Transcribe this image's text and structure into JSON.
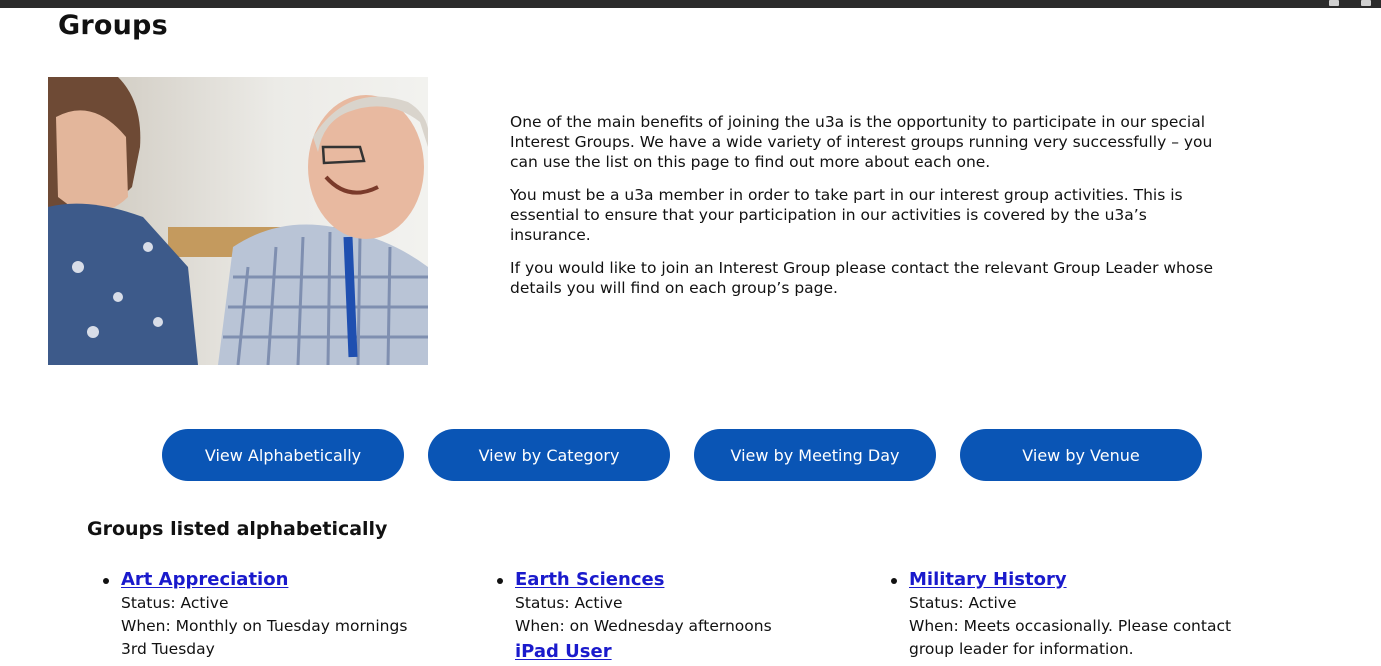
{
  "page": {
    "title": "Groups"
  },
  "intro": {
    "paragraphs": [
      "One of the main benefits of joining the u3a is the opportunity to participate in our special Interest Groups. We have a wide variety of interest groups running very successfully – you can use the list on this page to find out more about each one.",
      "You must be a u3a member in order to take part in our interest group activities. This is essential to ensure that your participation in our activities is covered by the u3a’s insurance.",
      "If you would like to join an Interest Group please contact the relevant Group Leader whose details you will find on each group’s page."
    ]
  },
  "view_buttons": [
    {
      "label": "View Alphabetically"
    },
    {
      "label": "View by Category"
    },
    {
      "label": "View by Meeting Day"
    },
    {
      "label": "View by Venue"
    }
  ],
  "list": {
    "heading": "Groups listed alphabetically",
    "columns": [
      [
        {
          "name": "Art Appreciation",
          "status": "Status: Active",
          "when": "When: Monthly on Tuesday mornings",
          "extra": "3rd Tuesday"
        }
      ],
      [
        {
          "name": "Earth Sciences",
          "status": "Status: Active",
          "when": "When: on Wednesday afternoons",
          "extra": ""
        },
        {
          "name": "iPad User",
          "status": "",
          "when": "",
          "extra": ""
        }
      ],
      [
        {
          "name": "Military History",
          "status": "Status: Active",
          "when": "When: Meets occasionally. Please contact",
          "extra": "group leader for information."
        }
      ]
    ]
  },
  "colors": {
    "button_bg": "#0a55b5",
    "link": "#1a1acc",
    "topbar": "#2b2b2b"
  }
}
